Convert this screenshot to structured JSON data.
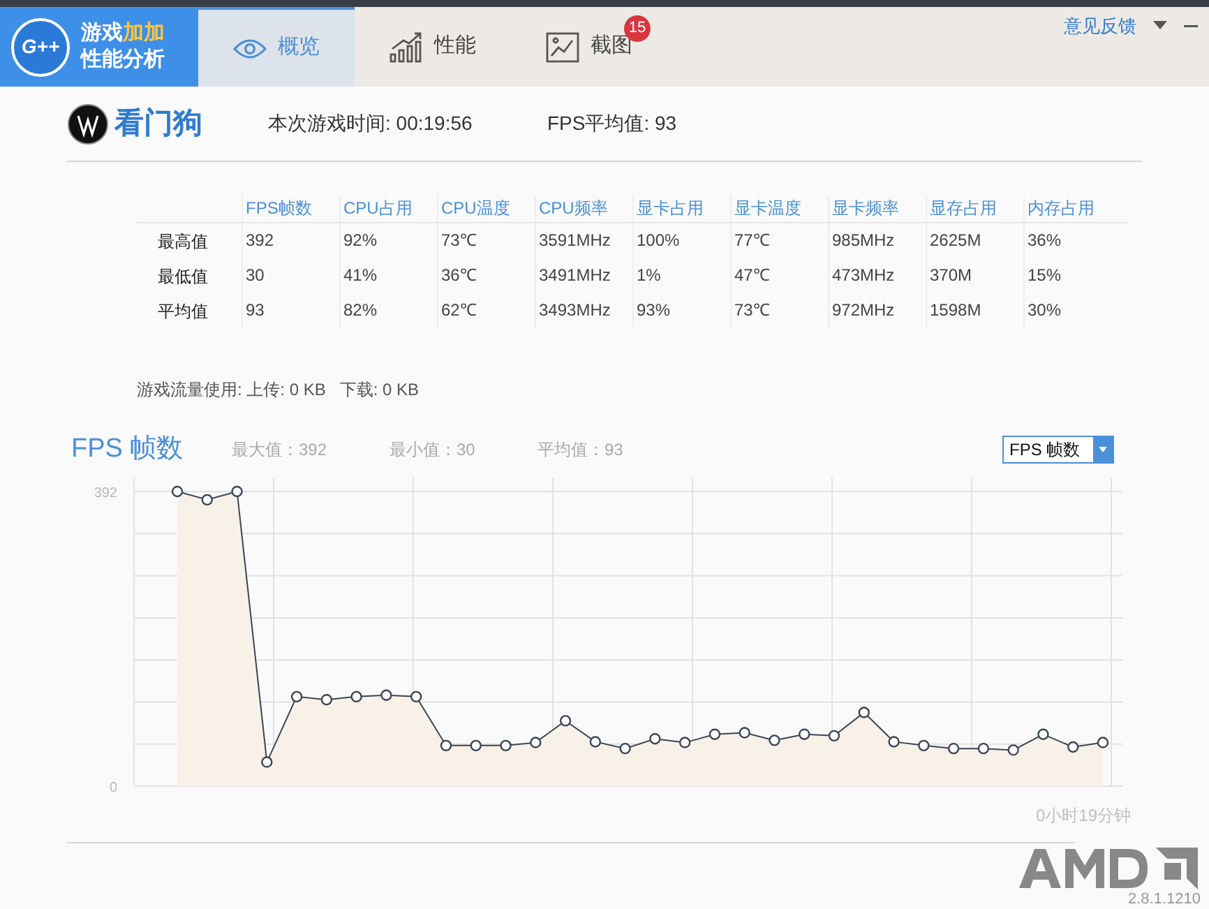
{
  "app": {
    "logo_badge": "G++",
    "title_line_1": "游戏",
    "title_highlight": "加加",
    "title_line_2": "性能分析"
  },
  "tabs": [
    {
      "label": "概览",
      "selected": true,
      "kind": "eye"
    },
    {
      "label": "性能",
      "selected": false,
      "kind": "chart"
    },
    {
      "label": "截图",
      "selected": false,
      "kind": "picture",
      "badge": "15"
    }
  ],
  "feedback_link": "意见反馈",
  "game": {
    "name": "看门狗",
    "session_time": "本次游戏时间: 00:19:56",
    "fps_average": "FPS平均值: 93"
  },
  "stats_table": {
    "columns": [
      "FPS帧数",
      "CPU占用",
      "CPU温度",
      "CPU频率",
      "显卡占用",
      "显卡温度",
      "显卡频率",
      "显存占用",
      "内存占用"
    ],
    "rows": [
      {
        "label": "最高值",
        "cells": [
          "392",
          "92%",
          "73℃",
          "3591MHz",
          "100%",
          "77℃",
          "985MHz",
          "2625M",
          "36%"
        ]
      },
      {
        "label": "最低值",
        "cells": [
          "30",
          "41%",
          "36℃",
          "3491MHz",
          "1%",
          "47℃",
          "473MHz",
          "370M",
          "15%"
        ]
      },
      {
        "label": "平均值",
        "cells": [
          "93",
          "82%",
          "62℃",
          "3493MHz",
          "93%",
          "73℃",
          "972MHz",
          "1598M",
          "30%"
        ]
      }
    ]
  },
  "traffic": "游戏流量使用: 上传: 0 KB   下载: 0 KB",
  "fps_section": {
    "title": "FPS 帧数",
    "max": "最大值：392",
    "min": "最小值：30",
    "avg": "平均值：93",
    "metric_select": "FPS 帧数",
    "chart_data": {
      "type": "area",
      "xlabel": "0小时19分钟",
      "ylim": [
        0,
        392
      ],
      "yticks": [
        {
          "value": 0,
          "label": "0"
        },
        {
          "value": 392,
          "label": "392"
        }
      ],
      "categories": [
        null,
        null,
        null,
        null,
        null,
        null,
        null,
        null,
        null,
        null,
        null,
        null,
        null,
        null,
        null,
        null,
        null,
        null,
        null,
        null,
        null,
        null,
        null,
        null,
        null,
        null,
        null,
        null,
        null,
        null,
        null,
        null
      ],
      "series": [
        {
          "color": "#3c4656",
          "values": [
            392,
            381,
            392,
            32,
            119,
            115,
            119,
            121,
            119,
            54,
            54,
            54,
            58,
            87,
            59,
            50,
            63,
            58,
            69,
            71,
            61,
            69,
            67,
            98,
            59,
            54,
            50,
            50,
            48,
            69,
            52,
            58
          ]
        }
      ]
    }
  },
  "version": "2.8.1.1210"
}
